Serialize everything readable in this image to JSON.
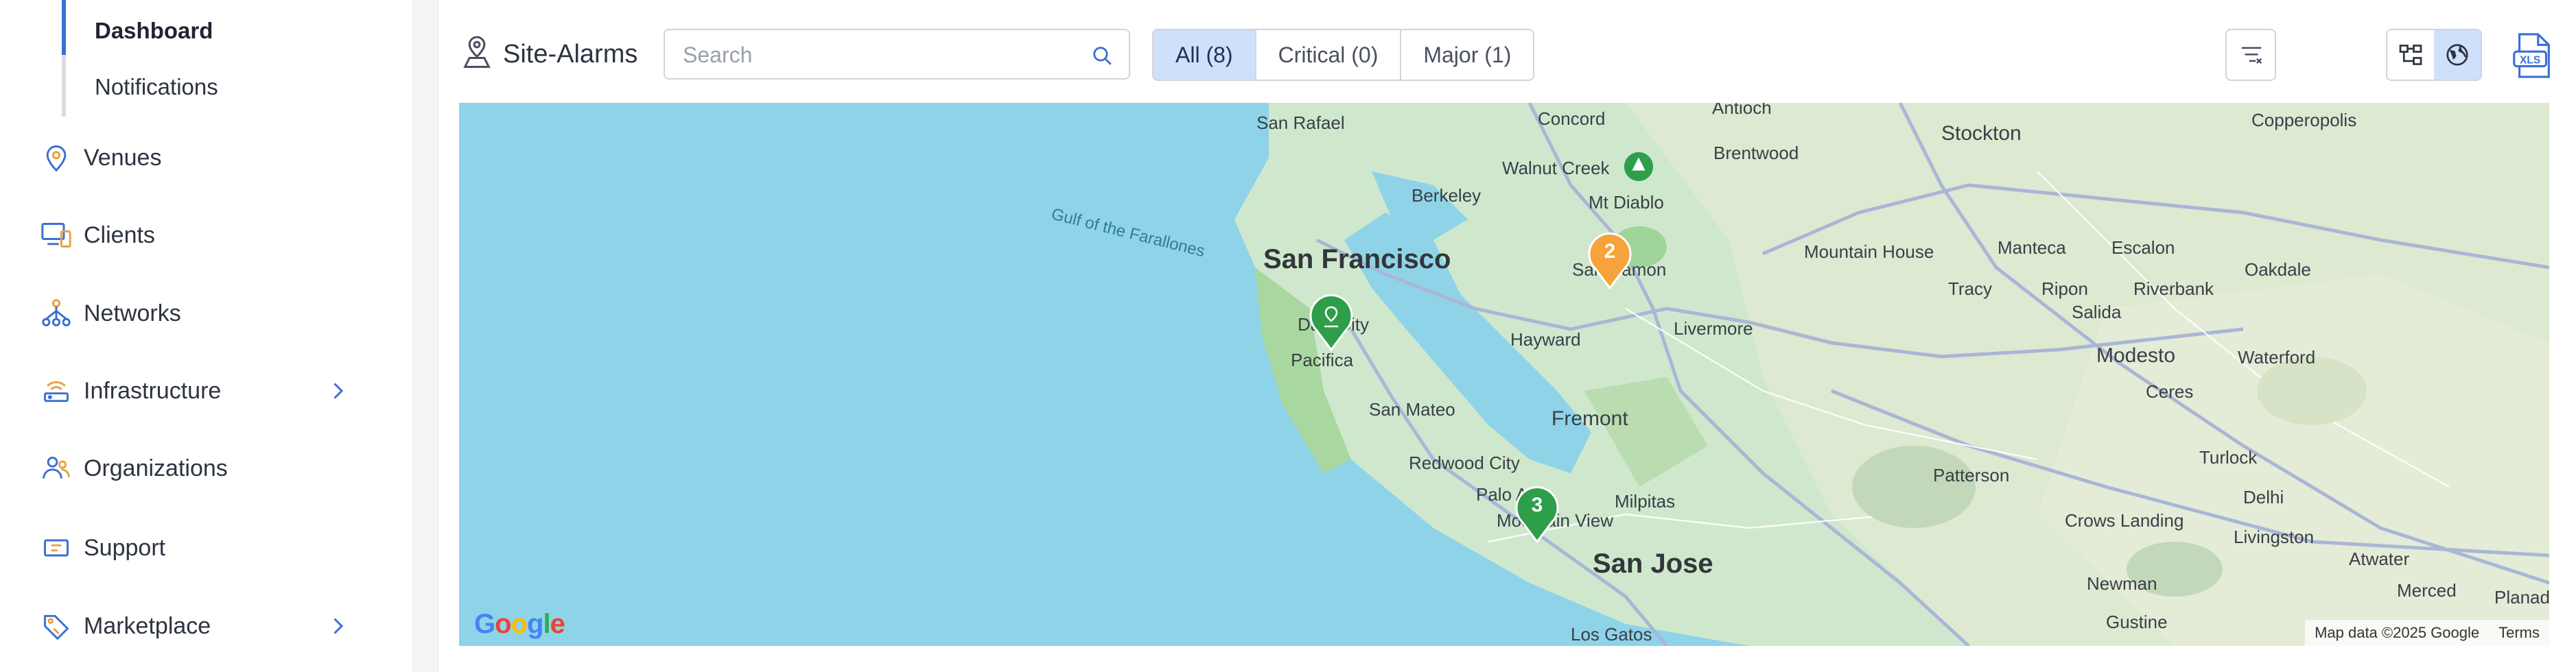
{
  "sidebar": {
    "sub_items": [
      {
        "label": "Dashboard",
        "active": true
      },
      {
        "label": "Notifications",
        "active": false
      }
    ],
    "items": [
      {
        "label": "Venues",
        "icon": "location-pin-icon",
        "has_chevron": false
      },
      {
        "label": "Clients",
        "icon": "devices-icon",
        "has_chevron": false
      },
      {
        "label": "Networks",
        "icon": "network-tree-icon",
        "has_chevron": false
      },
      {
        "label": "Infrastructure",
        "icon": "router-icon",
        "has_chevron": true
      },
      {
        "label": "Organizations",
        "icon": "organization-icon",
        "has_chevron": false
      },
      {
        "label": "Support",
        "icon": "support-ticket-icon",
        "has_chevron": false
      },
      {
        "label": "Marketplace",
        "icon": "tag-icon",
        "has_chevron": true
      }
    ],
    "accent_color": "#3b6fd4"
  },
  "panel": {
    "title": "Site-Alarms",
    "title_icon": "site-alarm-icon",
    "search": {
      "placeholder": "Search",
      "value": ""
    },
    "filters": [
      {
        "label": "All (8)",
        "active": true
      },
      {
        "label": "Critical (0)",
        "active": false
      },
      {
        "label": "Major (1)",
        "active": false
      }
    ],
    "filter_button_icon": "filter-lines-icon",
    "view_toggle": [
      {
        "icon": "topology-view-icon",
        "active": false
      },
      {
        "icon": "globe-map-view-icon",
        "active": true
      }
    ],
    "export_icon": "xls-export-icon"
  },
  "map": {
    "labels": {
      "san_rafael": "San Rafael",
      "concord": "Concord",
      "antioch": "Antioch",
      "stockton": "Stockton",
      "copperopolis": "Copperopolis",
      "walnut_creek": "Walnut Creek",
      "brentwood": "Brentwood",
      "berkeley": "Berkeley",
      "mt_diablo": "Mt Diablo",
      "gulf": "Gulf of the Farallones",
      "san_francisco": "San Francisco",
      "san_ramon": "San Ramon",
      "mountain_house": "Mountain House",
      "manteca": "Manteca",
      "escalon": "Escalon",
      "oakdale": "Oakdale",
      "tracy": "Tracy",
      "ripon": "Ripon",
      "riverbank": "Riverbank",
      "salida": "Salida",
      "daly_city": "Daly City",
      "pacifica": "Pacifica",
      "hayward": "Hayward",
      "livermore": "Livermore",
      "modesto": "Modesto",
      "waterford": "Waterford",
      "ceres": "Ceres",
      "san_mateo": "San Mateo",
      "fremont": "Fremont",
      "redwood_city": "Redwood City",
      "turlock": "Turlock",
      "patterson": "Patterson",
      "palo_alto": "Palo Alto",
      "milpitas": "Milpitas",
      "mountain_view": "Mountain View",
      "delhi": "Delhi",
      "crows_landing": "Crows Landing",
      "livingston": "Livingston",
      "san_jose": "San Jose",
      "atwater": "Atwater",
      "newman": "Newman",
      "merced": "Merced",
      "planada": "Planada",
      "gustine": "Gustine",
      "los_gatos": "Los Gatos"
    },
    "markers": [
      {
        "count": "2",
        "color": "#f5a33a"
      },
      {
        "count": "",
        "color": "#2e9e4a",
        "icon": "site-marker-icon"
      },
      {
        "count": "3",
        "color": "#2e9e4a"
      }
    ],
    "footer": {
      "attribution": "Map data ©2025 Google",
      "terms": "Terms"
    },
    "logo_text": "Google"
  }
}
